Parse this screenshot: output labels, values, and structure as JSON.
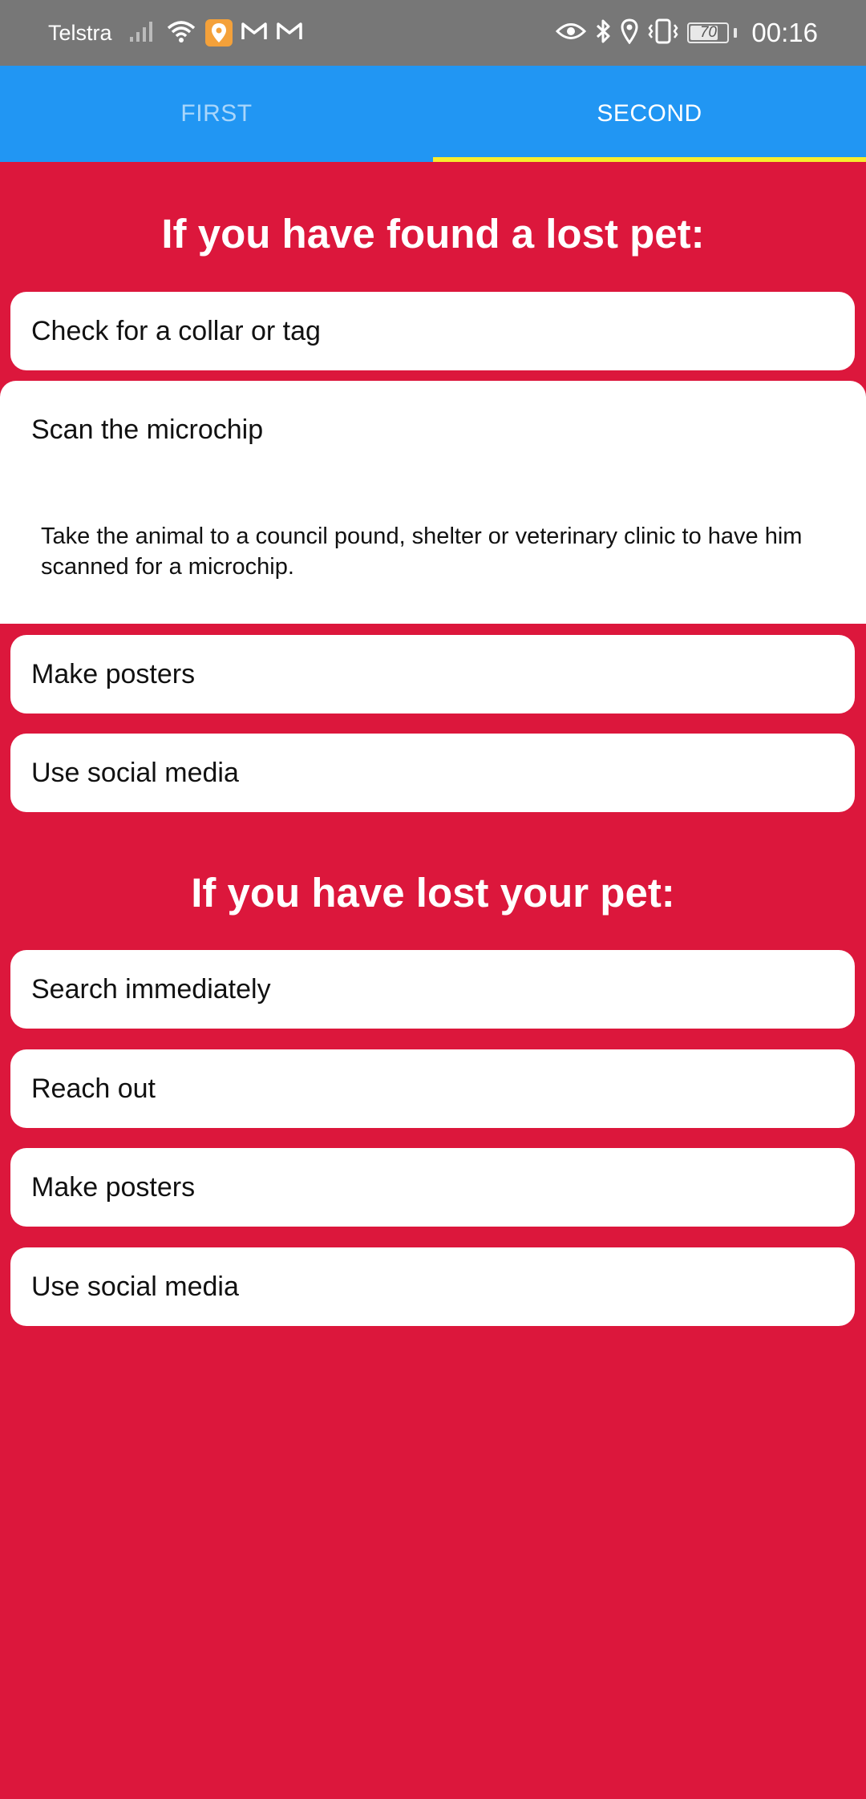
{
  "status_bar": {
    "carrier": "Telstra",
    "battery": "70",
    "time": "00:16"
  },
  "tabs": [
    {
      "label": "FIRST",
      "selected": false
    },
    {
      "label": "SECOND",
      "selected": true
    }
  ],
  "colors": {
    "background": "#DC173C",
    "tab_bar": "#2196F3",
    "tab_indicator": "#F8EC2E",
    "status_bar": "#777777"
  },
  "found_section": {
    "title": "If you have found a lost pet:",
    "items": [
      {
        "label": "Check for a collar or tag"
      },
      {
        "label": "Scan the microchip",
        "expanded": true,
        "body": "Take the animal to a council pound, shelter or veterinary clinic to have him scanned for a microchip."
      },
      {
        "label": "Make posters"
      },
      {
        "label": "Use social media"
      }
    ]
  },
  "lost_section": {
    "title": "If you have lost your pet:",
    "items": [
      {
        "label": "Search immediately"
      },
      {
        "label": "Reach out"
      },
      {
        "label": "Make posters"
      },
      {
        "label": "Use social media"
      }
    ]
  }
}
